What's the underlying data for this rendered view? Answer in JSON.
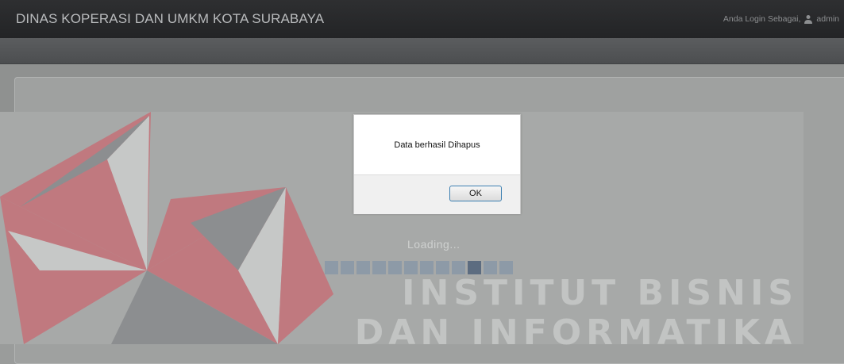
{
  "header": {
    "app_title": "DINAS KOPERASI DAN UMKM KOTA SURABAYA",
    "login_label": "Anda Login Sebagai,",
    "username": "admin"
  },
  "loading": {
    "text": "Loading...",
    "block_count": 12,
    "active_block": 9
  },
  "watermark": {
    "line1": "INSTITUT BISNIS",
    "line2": "DAN INFORMATIKA"
  },
  "dialog": {
    "message": "Data berhasil Dihapus",
    "ok_label": "OK"
  },
  "colors": {
    "logo_red": "#c0797f",
    "logo_gray": "#8c8e90",
    "logo_white": "#c6c8c7"
  }
}
